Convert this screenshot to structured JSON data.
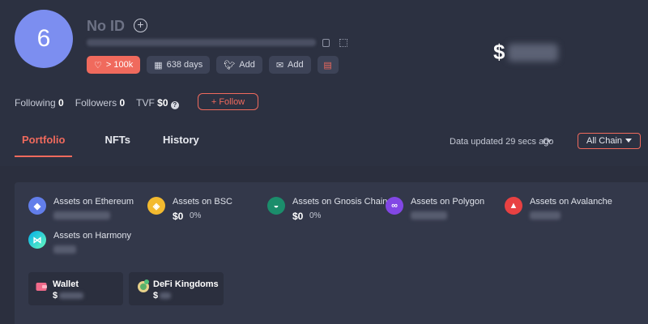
{
  "profile": {
    "avatar_text": "6",
    "name": "No ID",
    "badge_labels": [
      "> 100k",
      "638 days",
      "Add",
      "Add"
    ],
    "balance_prefix": "$"
  },
  "stats": {
    "following_label": "Following",
    "following_value": "0",
    "followers_label": "Followers",
    "followers_value": "0",
    "tvf_label": "TVF",
    "tvf_value": "$0",
    "follow_button": "+ Follow"
  },
  "tabs": [
    {
      "label": "Portfolio",
      "active": true
    },
    {
      "label": "NFTs",
      "active": false
    },
    {
      "label": "History",
      "active": false
    }
  ],
  "toolbar": {
    "updated_text": "Data updated 29 secs ago",
    "chain_filter": "All Chain"
  },
  "assets": [
    {
      "label": "Assets on Ethereum",
      "icon": "ethereum-icon",
      "color": "#627eea"
    },
    {
      "label": "Assets on BSC",
      "icon": "bsc-icon",
      "color": "#f3ba2f",
      "value": "$0",
      "pct": "0%"
    },
    {
      "label": "Assets on Gnosis Chain",
      "icon": "gnosis-icon",
      "color": "#1b8d6b",
      "value": "$0",
      "pct": "0%"
    },
    {
      "label": "Assets on Polygon",
      "icon": "polygon-icon",
      "color": "#8247e5"
    },
    {
      "label": "Assets on Avalanche",
      "icon": "avalanche-icon",
      "color": "#e84142"
    },
    {
      "label": "Assets on Harmony",
      "icon": "harmony-icon",
      "color": "#00aee9"
    }
  ],
  "protocols": [
    {
      "label": "Wallet",
      "icon": "wallet-icon",
      "value_prefix": "$"
    },
    {
      "label": "DeFi Kingdoms",
      "icon": "defi-kingdoms-icon",
      "value_prefix": "$"
    }
  ],
  "colors": {
    "accent": "#f06a5d",
    "background": "#2b2f3e",
    "panel": "#33384a",
    "avatar": "#7c8ef0"
  }
}
